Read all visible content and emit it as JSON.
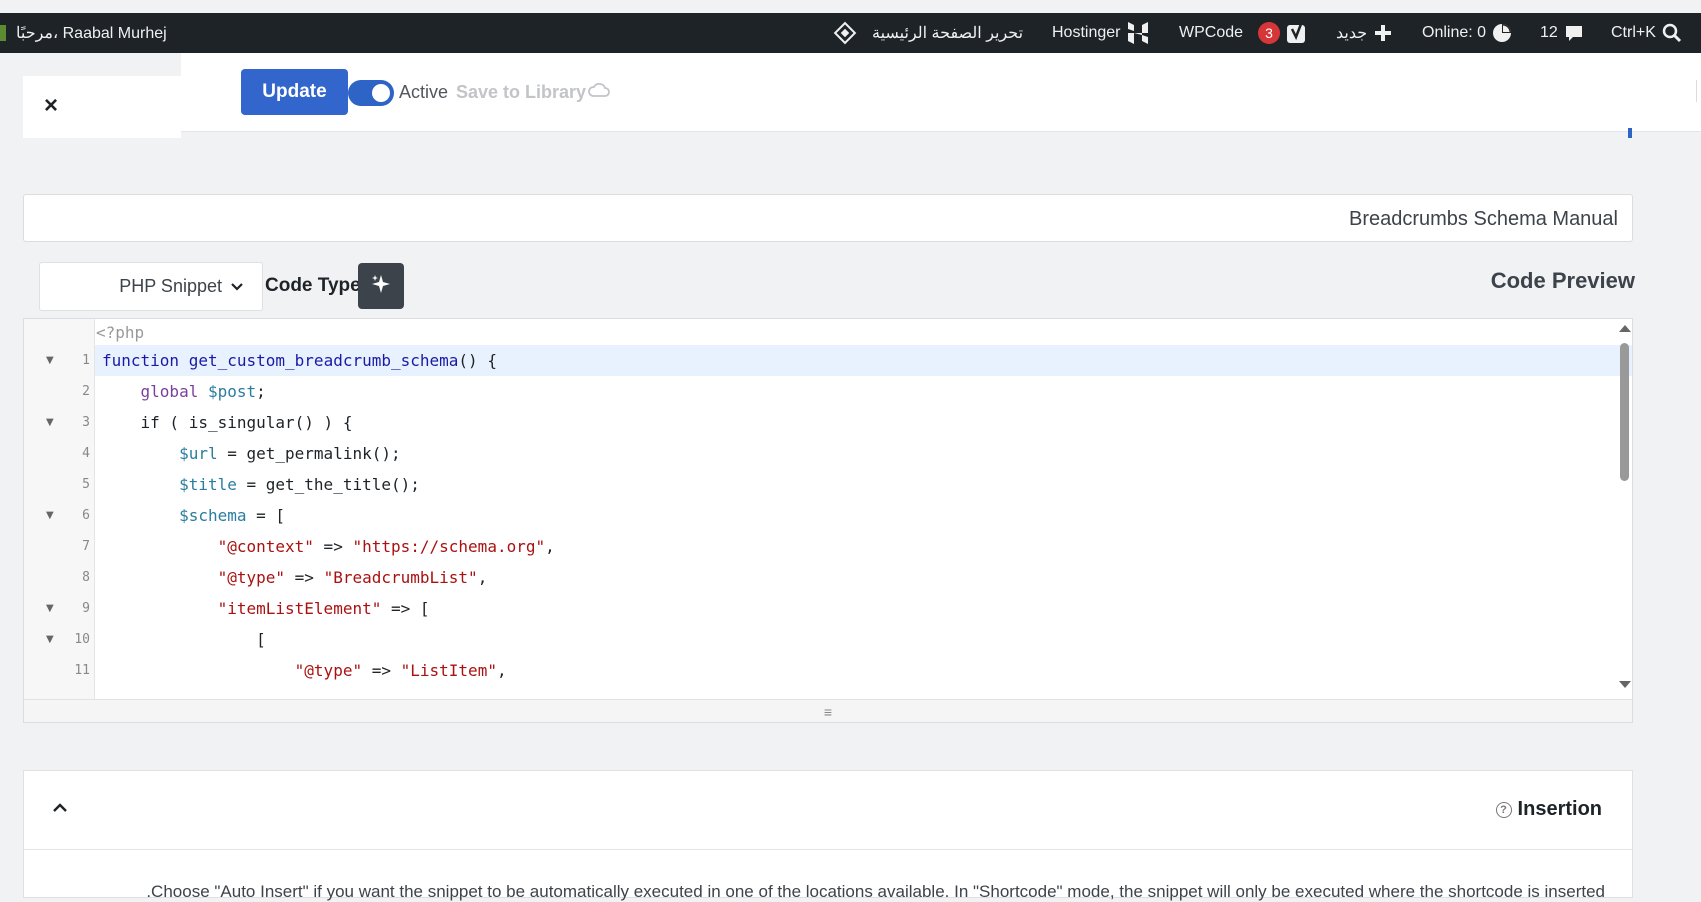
{
  "admin_bar": {
    "greeting": "مرحبًا، Raabal Murhej",
    "edit_home": "تحرير الصفحة الرئيسية",
    "hostinger": "Hostinger",
    "wpcode": "WPCode",
    "yoast_count": "3",
    "new_label": "جديد",
    "online": "Online: 0",
    "comments_count": "12",
    "shortcut": "Ctrl+K"
  },
  "toolbar": {
    "close": "×",
    "update_label": "Update",
    "active_label": "Active",
    "save_library_label": "Save to Library"
  },
  "snippet": {
    "title": "Breadcrumbs Schema Manual"
  },
  "code_type": {
    "label": "Code Type",
    "selected": "PHP Snippet",
    "preview_label": "Code Preview"
  },
  "editor": {
    "php_open": "<?php",
    "lines": [
      {
        "num": "1",
        "text": "function get_custom_breadcrumb_schema() {"
      },
      {
        "num": "2",
        "text": "    global $post;"
      },
      {
        "num": "3",
        "text": "    if ( is_singular() ) {"
      },
      {
        "num": "4",
        "text": "        $url = get_permalink();"
      },
      {
        "num": "5",
        "text": "        $title = get_the_title();"
      },
      {
        "num": "6",
        "text": "        $schema = ["
      },
      {
        "num": "7",
        "text": "            \"@context\" => \"https://schema.org\","
      },
      {
        "num": "8",
        "text": "            \"@type\" => \"BreadcrumbList\","
      },
      {
        "num": "9",
        "text": "            \"itemListElement\" => ["
      },
      {
        "num": "10",
        "text": "                ["
      },
      {
        "num": "11",
        "text": "                    \"@type\" => \"ListItem\","
      }
    ],
    "resize": "≡"
  },
  "insertion": {
    "title": "Insertion",
    "help": "?",
    "description": ".Choose \"Auto Insert\" if you want the snippet to be automatically executed in one of the locations available. In \"Shortcode\" mode, the snippet will only be executed where the shortcode is inserted"
  }
}
